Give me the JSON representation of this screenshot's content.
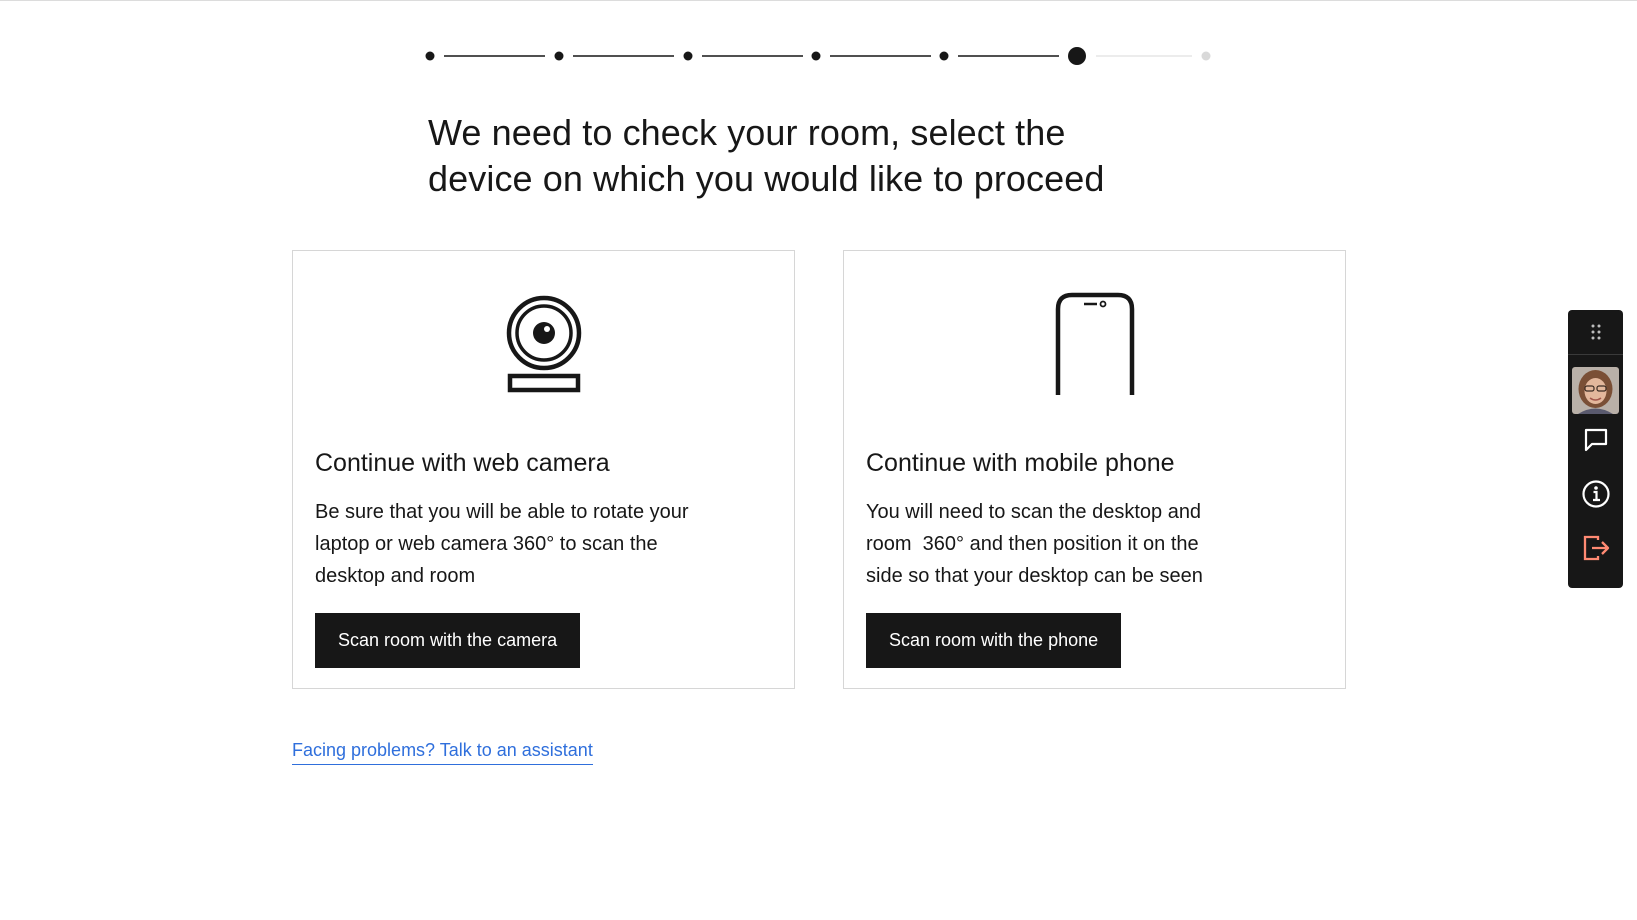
{
  "stepper": {
    "total_steps": 7,
    "current_step": 6
  },
  "heading": {
    "line1": "We need to check your room, select the",
    "line2": "device on which you would like to proceed"
  },
  "cards": [
    {
      "icon": "webcam-icon",
      "title": "Continue with web camera",
      "description": "Be sure that you will be able to rotate your\nlaptop or web camera 360° to scan the\ndesktop and room",
      "button_label": "Scan room with the camera"
    },
    {
      "icon": "mobile-phone-icon",
      "title": "Continue with mobile phone",
      "description": "You will need to scan the desktop and\nroom  360° and then position it on the\nside so that your desktop can be seen",
      "button_label": "Scan room with the phone"
    }
  ],
  "help_link": "Facing problems? Talk to an assistant",
  "side_panel": {
    "items": [
      "drag-handle-icon",
      "avatar",
      "chat-icon",
      "info-icon",
      "exit-icon"
    ],
    "exit_color": "#ff8a73"
  },
  "colors": {
    "text": "#171717",
    "link": "#2f6fdc",
    "inactive_step": "#d9d9d9",
    "button_bg": "#171717"
  }
}
